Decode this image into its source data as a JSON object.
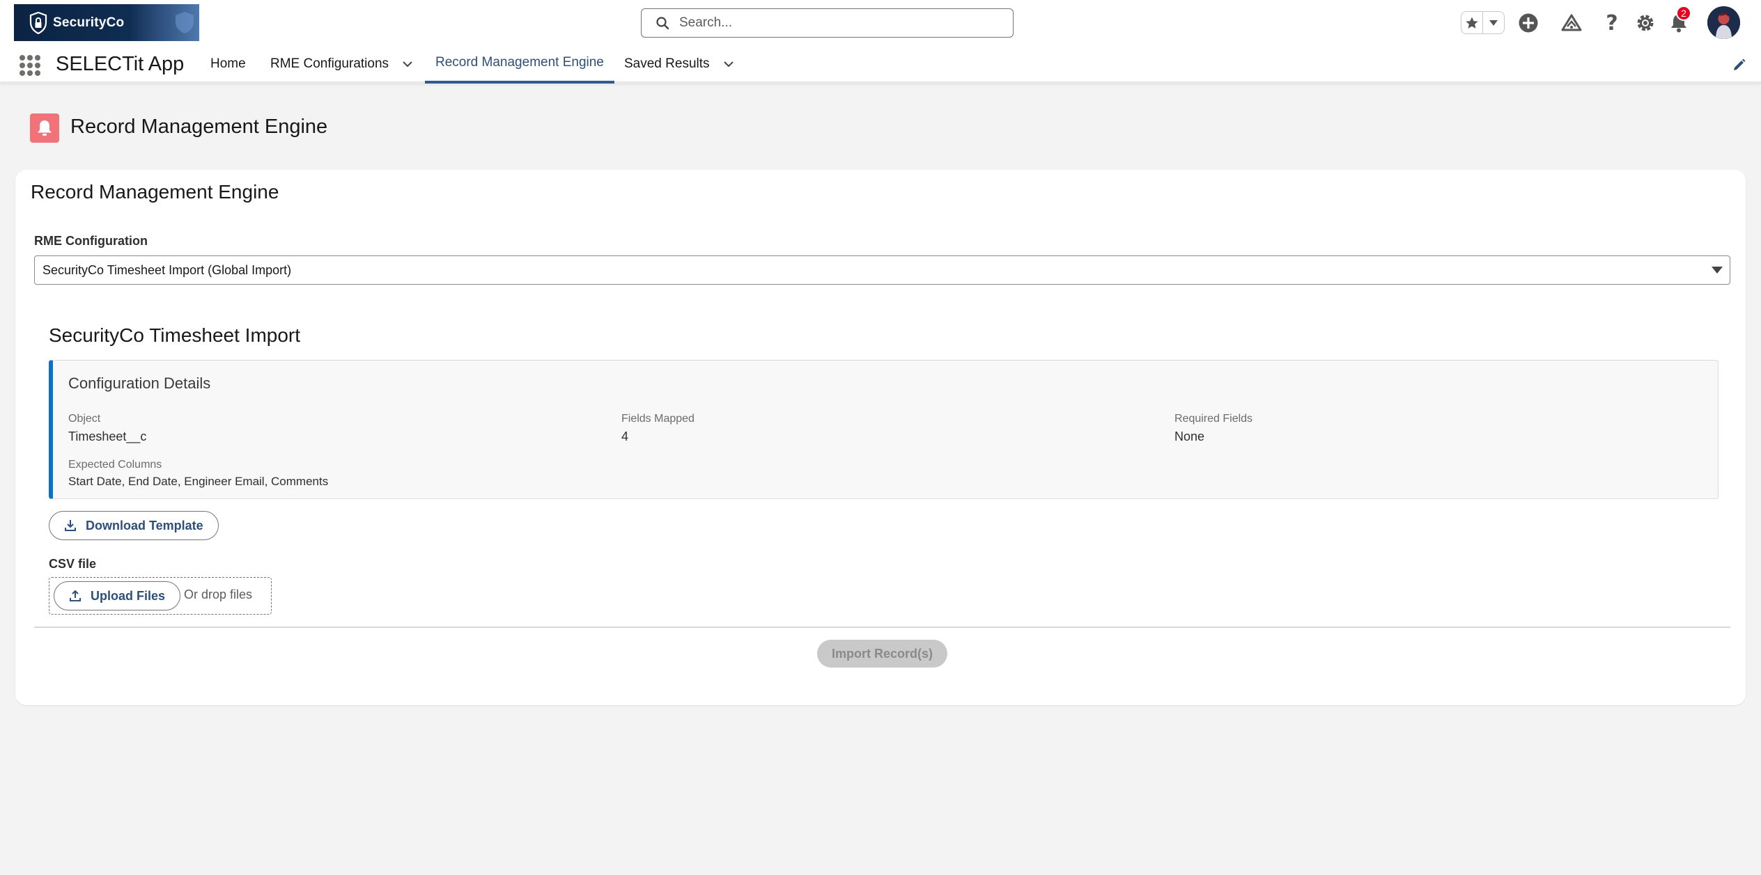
{
  "header": {
    "logo_text": "SecurityCo",
    "search_placeholder": "Search...",
    "notification_count": "2"
  },
  "nav": {
    "app_name": "SELECTit App",
    "tabs": [
      {
        "label": "Home"
      },
      {
        "label": "RME Configurations"
      },
      {
        "label": "Record Management Engine"
      },
      {
        "label": "Saved Results"
      }
    ]
  },
  "page": {
    "title": "Record Management Engine"
  },
  "card": {
    "title": "Record Management Engine",
    "rme_label": "RME Configuration",
    "rme_selected": "SecurityCo Timesheet Import (Global Import)",
    "section_title": "SecurityCo Timesheet Import",
    "config": {
      "title": "Configuration Details",
      "object_label": "Object",
      "object_value": "Timesheet__c",
      "fields_mapped_label": "Fields Mapped",
      "fields_mapped_value": "4",
      "required_label": "Required Fields",
      "required_value": "None",
      "expected_label": "Expected Columns",
      "expected_value": "Start Date, End Date, Engineer Email, Comments"
    },
    "download_button": "Download Template",
    "csv_label": "CSV file",
    "upload_button": "Upload Files",
    "drop_text": "Or drop files",
    "import_button": "Import Record(s)"
  },
  "colors": {
    "active_tab": "#2e4f78",
    "page_icon_bg": "#f2727a",
    "config_accent": "#0b72c9",
    "badge": "#ea001e"
  }
}
